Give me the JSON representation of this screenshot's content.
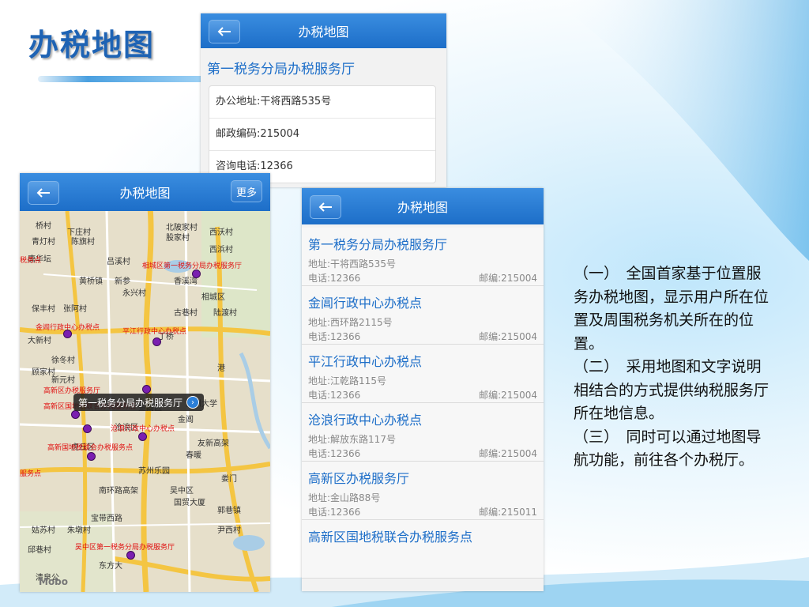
{
  "slide": {
    "title": "办税地图",
    "description": [
      "（一）　全国首家基于位置服务办税地图，显示用户所在位置及周围税务机关所在的位置。",
      "（二）　采用地图和文字说明相结合的方式提供纳税服务厅所在地信息。",
      "（三）　同时可以通过地图导航功能，前往各个办税厅。"
    ]
  },
  "screen_detail": {
    "nav_title": "办税地图",
    "office_name": "第一税务分局办税服务厅",
    "address": "办公地址:干将西路535号",
    "postcode": "邮政编码:215004",
    "phone": "咨询电话:12366"
  },
  "screen_map": {
    "nav_title": "办税地图",
    "more_label": "更多",
    "callout": "第一税务分局办税服务厅",
    "logo": "Mobo",
    "labels": [
      "桥村",
      "下庄村",
      "北陂家村",
      "西沃村",
      "青灯村",
      "陈旗村",
      "股家村",
      "西浜村",
      "唐华坛",
      "吕溪村",
      "黄桥镇",
      "新参",
      "香溪湾",
      "永兴村",
      "相城区",
      "保丰村",
      "张阿村",
      "古巷村",
      "陆渡村",
      "大新村",
      "徐冬村",
      "丁桥",
      "顾家村",
      "金阊区",
      "苏州大学",
      "新元村",
      "金阊",
      "沧浪区",
      "虎丘区",
      "春暖",
      "苏州乐园",
      "南环路高架",
      "吴中区",
      "国贸大厦",
      "郭巷镇",
      "宝带西路",
      "姑苏村",
      "朱墩村",
      "尹西村",
      "邱巷村",
      "清泉公",
      "东方大",
      "友新高架",
      "娄门",
      "港"
    ],
    "red_labels": [
      "相城区第一税务分局办税服务厅",
      "金阊行政中心办税点",
      "平江行政中心办税点",
      "高新区办税服务厅",
      "高新区国地税联合办税服务点",
      "沧浪行政中心办税点",
      "高新国地税联合办税服务点",
      "吴中区第一税务分局办税服务厅",
      "税务点",
      "服务点"
    ]
  },
  "screen_list": {
    "nav_title": "办税地图",
    "items": [
      {
        "name": "第一税务分局办税服务厅",
        "address": "地址:干将西路535号",
        "phone": "电话:12366",
        "postcode": "邮编:215004"
      },
      {
        "name": "金阊行政中心办税点",
        "address": "地址:西环路2115号",
        "phone": "电话:12366",
        "postcode": "邮编:215004"
      },
      {
        "name": "平江行政中心办税点",
        "address": "地址:江乾路115号",
        "phone": "电话:12366",
        "postcode": "邮编:215004"
      },
      {
        "name": "沧浪行政中心办税点",
        "address": "地址:解放东路117号",
        "phone": "电话:12366",
        "postcode": "邮编:215004"
      },
      {
        "name": "高新区办税服务厅",
        "address": "地址:金山路88号",
        "phone": "电话:12366",
        "postcode": "邮编:215011"
      },
      {
        "name": "高新区国地税联合办税服务点",
        "address": "",
        "phone": "",
        "postcode": ""
      }
    ]
  },
  "colors": {
    "accent": "#1d6ec8",
    "nav": "#2a7ed8",
    "map_route": "#f5c33b",
    "pin": "#7a1fb0"
  }
}
